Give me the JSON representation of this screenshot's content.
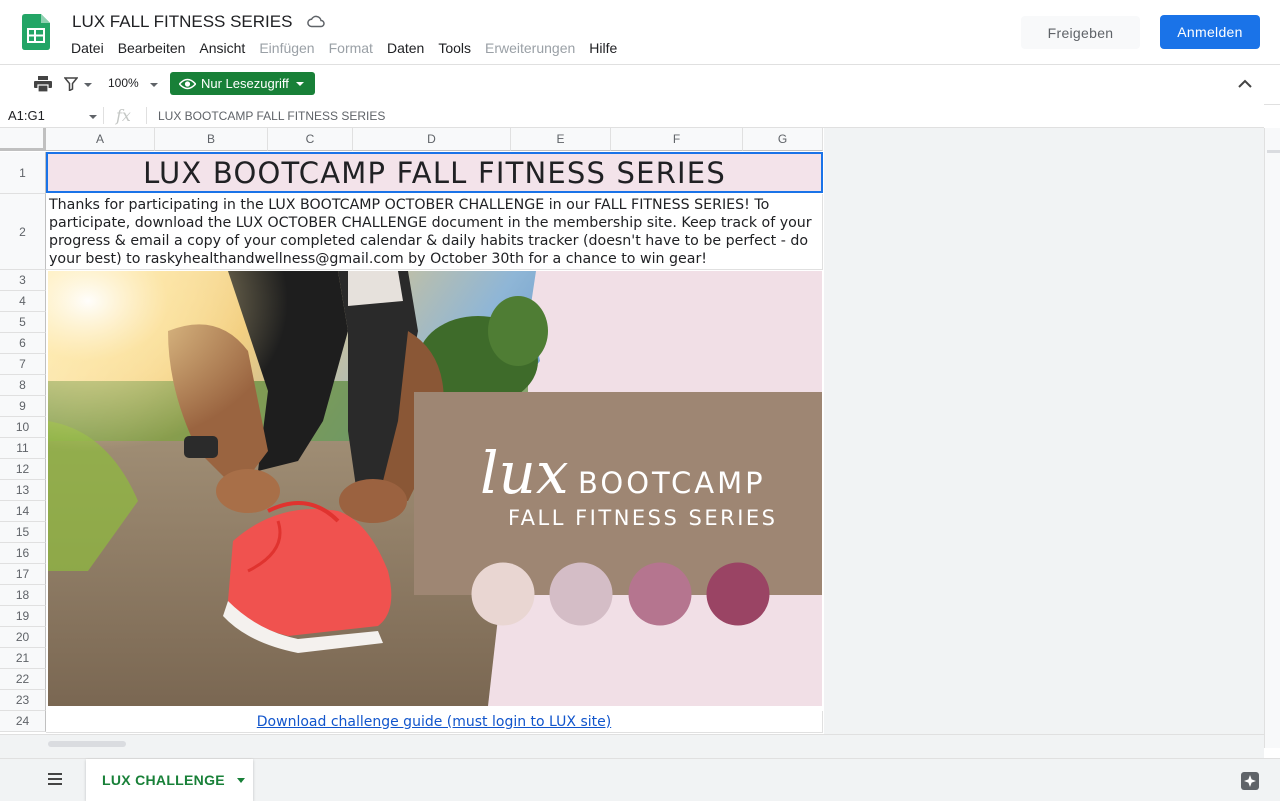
{
  "header": {
    "title": "LUX FALL FITNESS SERIES",
    "menu": [
      {
        "label": "Datei",
        "enabled": true
      },
      {
        "label": "Bearbeiten",
        "enabled": true
      },
      {
        "label": "Ansicht",
        "enabled": true
      },
      {
        "label": "Einfügen",
        "enabled": false
      },
      {
        "label": "Format",
        "enabled": false
      },
      {
        "label": "Daten",
        "enabled": true
      },
      {
        "label": "Tools",
        "enabled": true
      },
      {
        "label": "Erweiterungen",
        "enabled": false
      },
      {
        "label": "Hilfe",
        "enabled": true
      }
    ],
    "share_label": "Freigeben",
    "signin_label": "Anmelden"
  },
  "toolbar": {
    "zoom": "100%",
    "readonly_label": "Nur Lesezugriff"
  },
  "formula_bar": {
    "name_box": "A1:G1",
    "content": "LUX BOOTCAMP FALL FITNESS SERIES"
  },
  "grid": {
    "columns": [
      "A",
      "B",
      "C",
      "D",
      "E",
      "F",
      "G"
    ],
    "rows": [
      "1",
      "2",
      "3",
      "4",
      "5",
      "6",
      "7",
      "8",
      "9",
      "10",
      "11",
      "12",
      "13",
      "14",
      "15",
      "16",
      "17",
      "18",
      "19",
      "20",
      "21",
      "22",
      "23",
      "24"
    ],
    "title_cell": "LUX BOOTCAMP FALL FITNESS SERIES",
    "intro_text": "Thanks for participating in the LUX BOOTCAMP OCTOBER CHALLENGE in our FALL FITNESS SERIES! To participate, download the LUX OCTOBER CHALLENGE document in the membership site. Keep track of your progress & email a copy of your completed calendar & daily habits tracker (doesn't have to be perfect - do your best) to raskyhealthandwellness@gmail.com by October 30th for a chance to win gear!",
    "link_text": "Download challenge guide (must login to LUX site)"
  },
  "banner": {
    "script_word": "lux",
    "brand_word": "BOOTCAMP",
    "series_text": "FALL FITNESS SERIES",
    "swatches": [
      "#e9d6d2",
      "#d4bdc6",
      "#b5758f",
      "#9a4464"
    ],
    "panel_color": "#9e8673",
    "background_color": "#f1dfe6"
  },
  "sheets": {
    "active_tab": "LUX CHALLENGE"
  },
  "colors": {
    "accent_blue": "#1a73e8",
    "readonly_green": "#188038",
    "link_blue": "#1155cc"
  }
}
